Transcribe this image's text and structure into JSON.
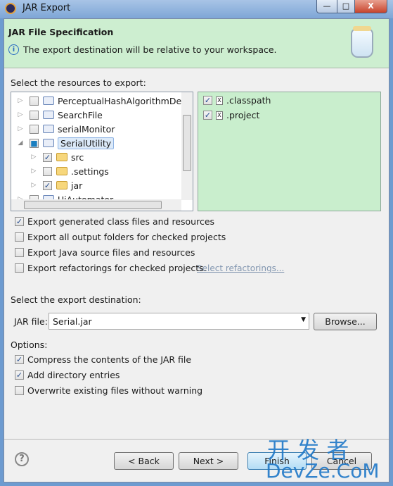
{
  "window": {
    "title": "JAR Export",
    "minimize": "—",
    "maximize": "□",
    "close": "X"
  },
  "header": {
    "title": "JAR File Specification",
    "message": "The export destination will be relative to your workspace."
  },
  "resources": {
    "label": "Select the resources to export:",
    "tree": [
      {
        "label": "PerceptualHashAlgorithmDemo",
        "level": 0,
        "checked": "none",
        "expanded": false
      },
      {
        "label": "SearchFile",
        "level": 0,
        "checked": "none",
        "expanded": false
      },
      {
        "label": "serialMonitor",
        "level": 0,
        "checked": "none",
        "expanded": false,
        "error": true
      },
      {
        "label": "SerialUtility",
        "level": 0,
        "checked": "partial",
        "expanded": true,
        "selected": true
      },
      {
        "label": "src",
        "level": 1,
        "checked": "checked",
        "expanded": false
      },
      {
        "label": ".settings",
        "level": 1,
        "checked": "none",
        "expanded": false
      },
      {
        "label": "jar",
        "level": 1,
        "checked": "checked",
        "expanded": false
      },
      {
        "label": "UiAutomator",
        "level": 0,
        "checked": "none",
        "expanded": false
      }
    ],
    "files": [
      {
        "label": ".classpath",
        "checked": true
      },
      {
        "label": ".project",
        "checked": true
      }
    ]
  },
  "export_options": [
    {
      "label": "Export generated class files and resources",
      "checked": true
    },
    {
      "label": "Export all output folders for checked projects",
      "checked": false
    },
    {
      "label": "Export Java source files and resources",
      "checked": false
    },
    {
      "label": "Export refactorings for checked projects.",
      "checked": false
    }
  ],
  "select_refactorings": "Select refactorings...",
  "destination": {
    "label": "Select the export destination:",
    "jar_label": "JAR file:",
    "jar_value": "Serial.jar",
    "browse": "Browse..."
  },
  "options": {
    "label": "Options:",
    "items": [
      {
        "label": "Compress the contents of the JAR file",
        "checked": true
      },
      {
        "label": "Add directory entries",
        "checked": true
      },
      {
        "label": "Overwrite existing files without warning",
        "checked": false
      }
    ]
  },
  "buttons": {
    "help": "?",
    "back": "< Back",
    "next": "Next >",
    "finish": "Finish",
    "cancel": "Cancel"
  },
  "watermark": {
    "line1": "开 发 者",
    "line2": "DevZe.CoM"
  }
}
